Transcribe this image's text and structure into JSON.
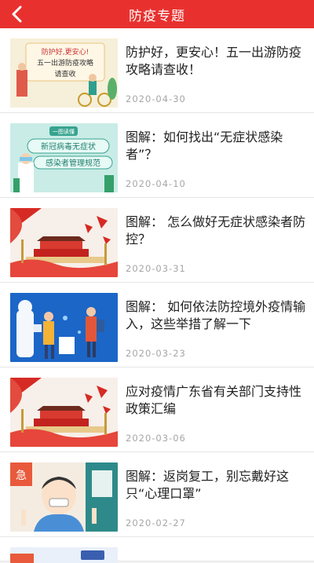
{
  "header": {
    "title": "防疫专题",
    "back_icon": "chevron-left-icon",
    "bg_color": "#e8312f"
  },
  "articles": [
    {
      "title": "防护好，更安心！五一出游防疫攻略请查收！",
      "date": "2020-04-30",
      "thumb_text": [
        "防护好,更安心!",
        "五一出游防疫攻略",
        "请查收"
      ]
    },
    {
      "title": "图解：如何找出“无症状感染者”？",
      "date": "2020-04-10",
      "thumb_text": [
        "一图读懂",
        "新冠病毒无症状",
        "感染者管理规范"
      ]
    },
    {
      "title": "图解： 怎么做好无症状感染者防控？",
      "date": "2020-03-31"
    },
    {
      "title": "图解： 如何依法防控境外疫情输入，这些举措了解一下",
      "date": "2020-03-23"
    },
    {
      "title": "应对疫情广东省有关部门支持性政策汇编",
      "date": "2020-03-06"
    },
    {
      "title": "图解：返岗复工，别忘戴好这只“心理口罩”",
      "date": "2020-02-27",
      "thumb_text": [
        "急"
      ]
    }
  ]
}
